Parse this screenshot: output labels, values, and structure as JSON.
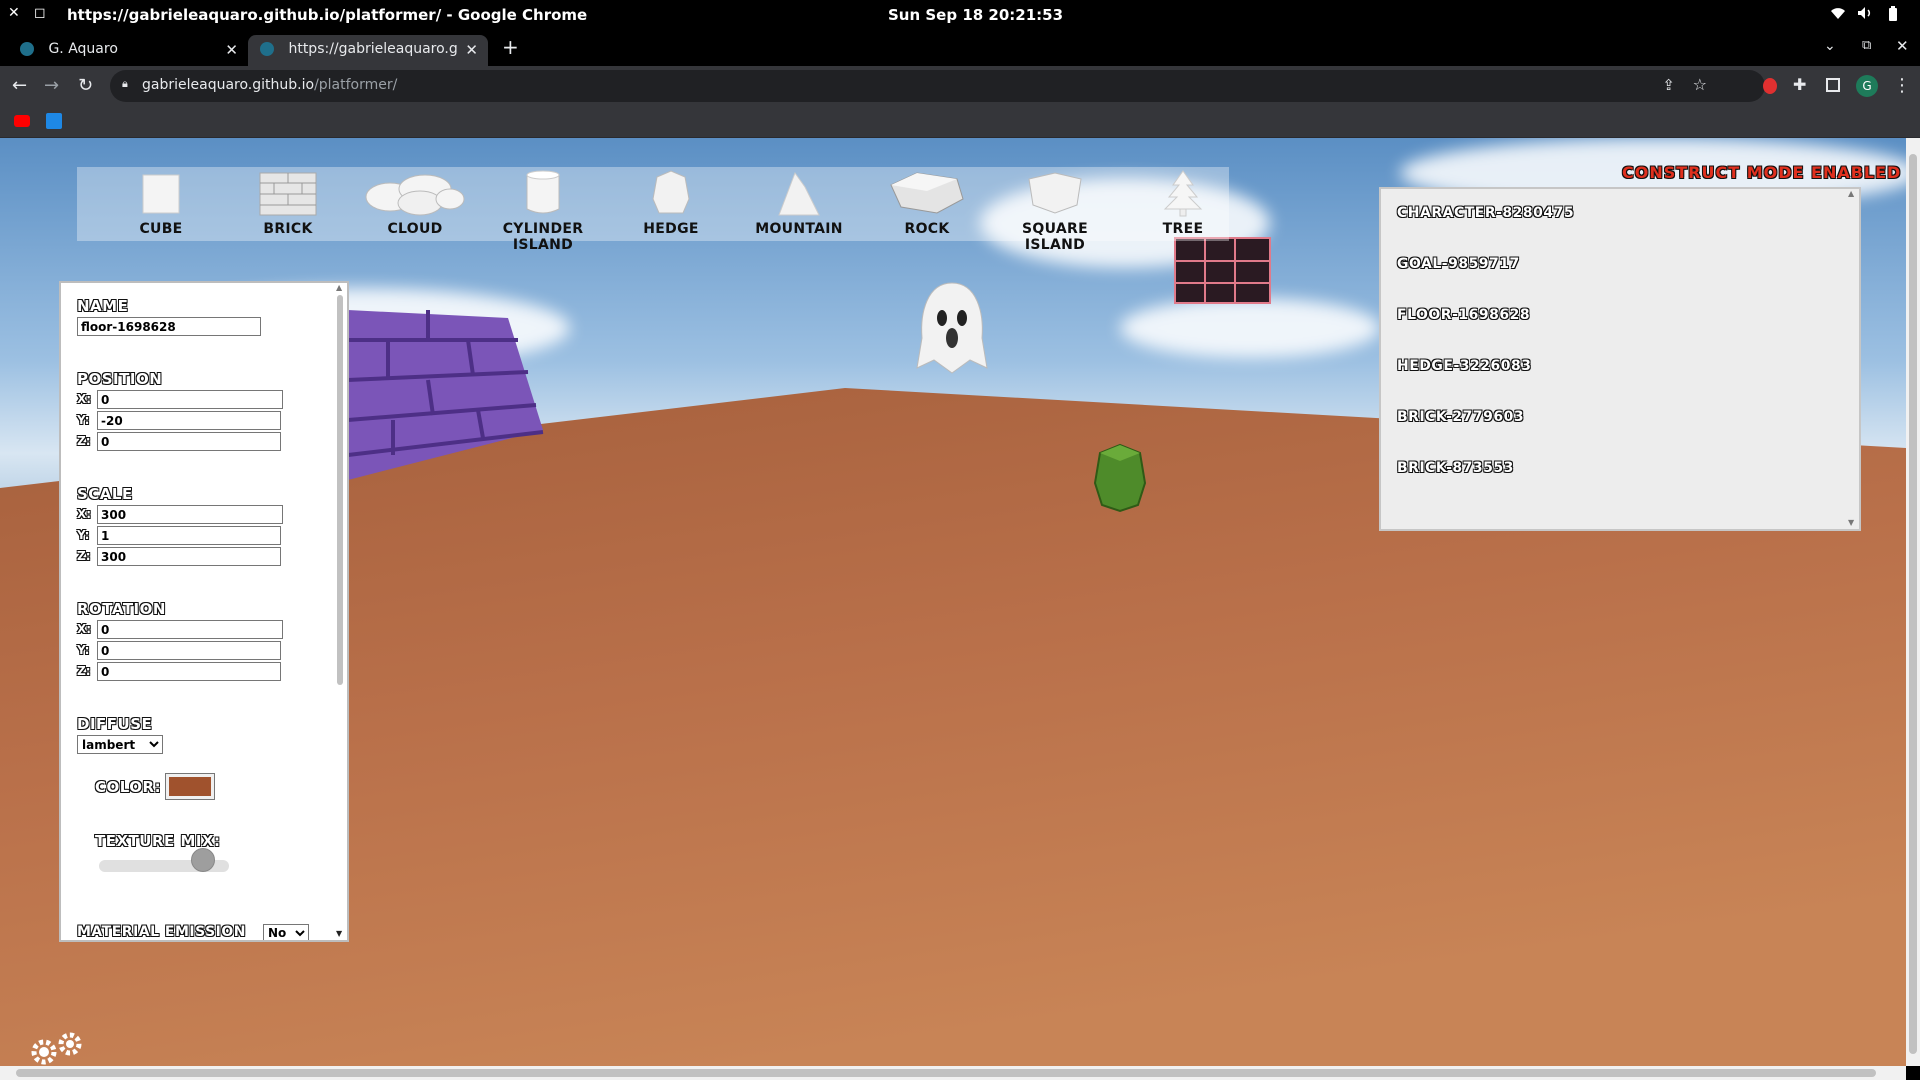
{
  "os": {
    "window_title": "https://gabrieleaquaro.github.io/platformer/ - Google Chrome",
    "clock": "Sun Sep 18  20:21:53"
  },
  "browser": {
    "tabs": [
      {
        "title": "G. Aquaro",
        "active": false
      },
      {
        "title": "https://gabrieleaquaro.github.io/platformer/",
        "active": true
      }
    ],
    "url_host": "gabrieleaquaro.github.io",
    "url_path": "/platformer/",
    "profile_initial": "G"
  },
  "game": {
    "mode_status": "CONSTRUCT MODE ENABLED",
    "toolbox": [
      {
        "label": "CUBE",
        "icon": "cube-icon"
      },
      {
        "label": "BRICK",
        "icon": "brick-icon"
      },
      {
        "label": "CLOUD",
        "icon": "cloud-icon"
      },
      {
        "label": "CYLINDER ISLAND",
        "icon": "cylinder-island-icon"
      },
      {
        "label": "HEDGE",
        "icon": "hedge-icon"
      },
      {
        "label": "MOUNTAIN",
        "icon": "mountain-icon"
      },
      {
        "label": "ROCK",
        "icon": "rock-icon"
      },
      {
        "label": "SQUARE ISLAND",
        "icon": "square-island-icon"
      },
      {
        "label": "TREE",
        "icon": "tree-icon"
      }
    ],
    "objects": [
      "CHARACTER-8280475",
      "GOAL-9859717",
      "FLOOR-1698628",
      "HEDGE-3226083",
      "BRICK-2779603",
      "BRICK-873553"
    ],
    "properties": {
      "name_label": "NAME",
      "name_value": "floor-1698628",
      "position_label": "POSITION",
      "position": {
        "x": "0",
        "y": "-20",
        "z": "0"
      },
      "scale_label": "SCALE",
      "scale": {
        "x": "300",
        "y": "1",
        "z": "300"
      },
      "rotation_label": "ROTATION",
      "rotation": {
        "x": "0",
        "y": "0",
        "z": "0"
      },
      "axis_labels": {
        "x": "X:",
        "y": "Y:",
        "z": "Z:"
      },
      "diffuse_label": "DIFFUSE",
      "diffuse_value": "lambert",
      "color_label": "COLOR:",
      "color_value": "#a0522d",
      "texture_mix_label": "TEXTURE MIX:",
      "texture_mix": 0.8,
      "emission_label": "MATERIAL EMISSION",
      "emission_value": "No"
    },
    "colors": {
      "floor": "#b9704a",
      "brick_wall": "#7b55b8",
      "hedge": "#4e8b2a",
      "mode_red": "#e0301e"
    }
  }
}
